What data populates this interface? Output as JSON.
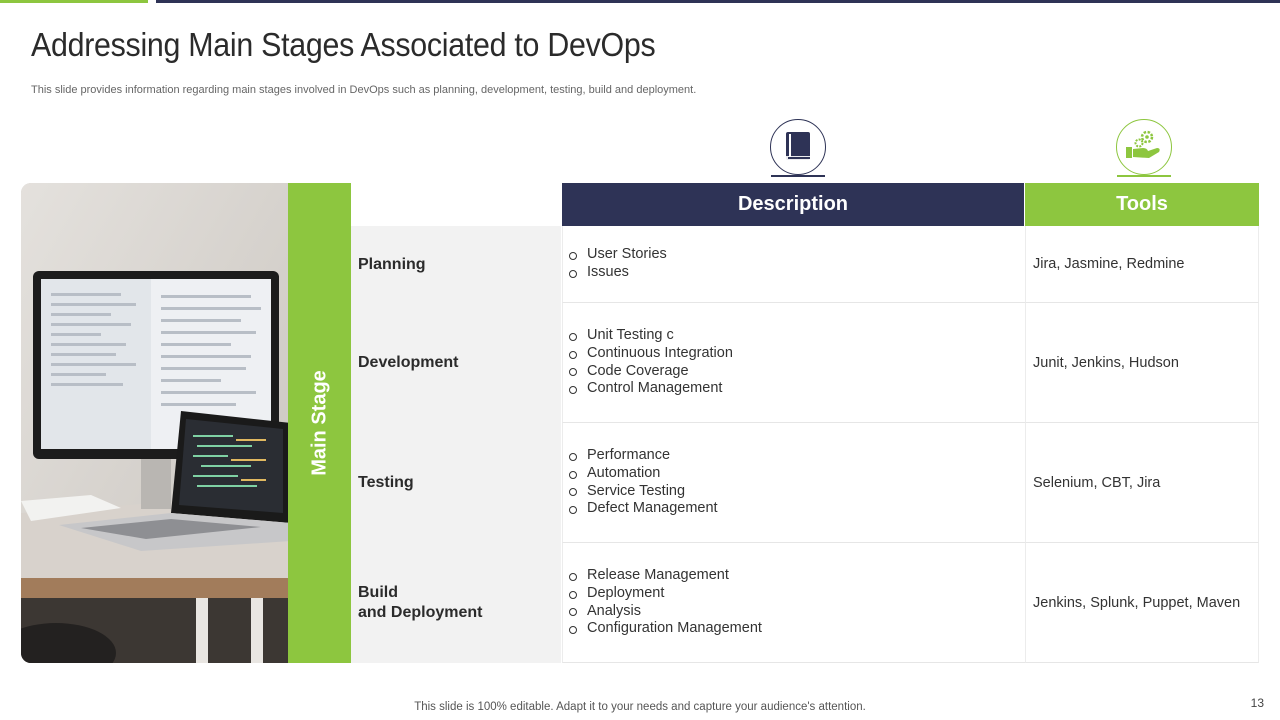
{
  "title": "Addressing Main Stages Associated to DevOps",
  "subtitle": "This slide provides information regarding main stages involved in DevOps such as planning, development, testing, build and deployment.",
  "main_stage_label": "Main Stage",
  "headers": {
    "description": "Description",
    "tools": "Tools"
  },
  "icons": {
    "description": "book-icon",
    "tools": "gear-hand-icon"
  },
  "rows": [
    {
      "stage": "Planning",
      "items": [
        "User Stories",
        "Issues"
      ],
      "tools": "Jira, Jasmine, Redmine"
    },
    {
      "stage": "Development",
      "items": [
        "Unit Testing c",
        "Continuous Integration",
        "Code Coverage",
        "Control Management"
      ],
      "tools": "Junit, Jenkins, Hudson"
    },
    {
      "stage": "Testing",
      "items": [
        "Performance",
        "Automation",
        "Service Testing",
        "Defect Management"
      ],
      "tools": "Selenium, CBT, Jira"
    },
    {
      "stage": "Build\nand Deployment",
      "items": [
        "Release Management",
        "Deployment",
        "Analysis",
        "Configuration Management"
      ],
      "tools": "Jenkins, Splunk, Puppet, Maven"
    }
  ],
  "footer": "This slide is 100% editable. Adapt it to your needs and capture your audience's attention.",
  "page_number": "13",
  "colors": {
    "navy": "#2e3356",
    "green": "#8dc63f"
  }
}
